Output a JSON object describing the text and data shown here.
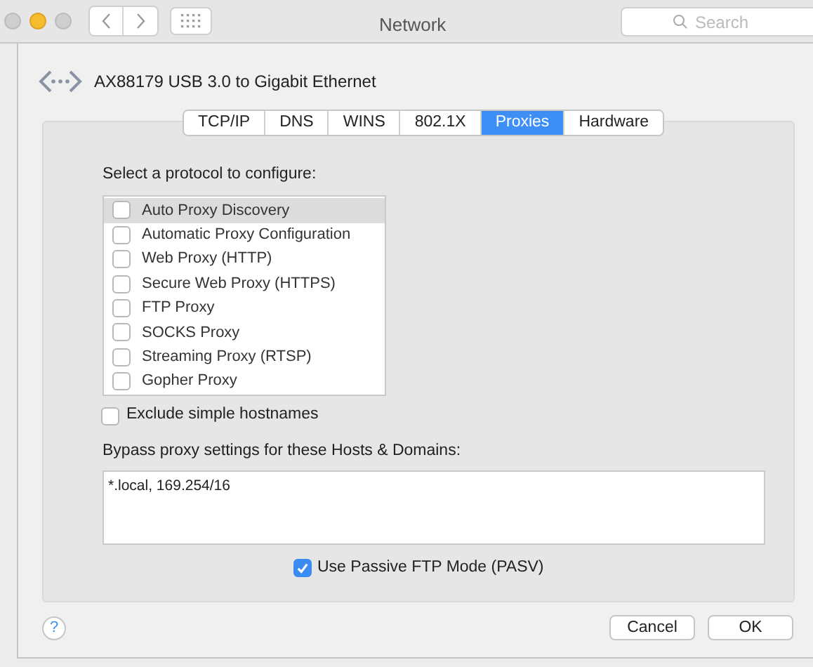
{
  "window": {
    "title": "Network",
    "search": {
      "placeholder": "Search"
    }
  },
  "device": {
    "name": "AX88179 USB 3.0 to Gigabit Ethernet"
  },
  "tabs": [
    {
      "label": "TCP/IP",
      "selected": false
    },
    {
      "label": "DNS",
      "selected": false
    },
    {
      "label": "WINS",
      "selected": false
    },
    {
      "label": "802.1X",
      "selected": false
    },
    {
      "label": "Proxies",
      "selected": true
    },
    {
      "label": "Hardware",
      "selected": false
    }
  ],
  "protocols": {
    "label": "Select a protocol to configure:",
    "items": [
      {
        "label": "Auto Proxy Discovery",
        "checked": false,
        "selected": true
      },
      {
        "label": "Automatic Proxy Configuration",
        "checked": false,
        "selected": false
      },
      {
        "label": "Web Proxy (HTTP)",
        "checked": false,
        "selected": false
      },
      {
        "label": "Secure Web Proxy (HTTPS)",
        "checked": false,
        "selected": false
      },
      {
        "label": "FTP Proxy",
        "checked": false,
        "selected": false
      },
      {
        "label": "SOCKS Proxy",
        "checked": false,
        "selected": false
      },
      {
        "label": "Streaming Proxy (RTSP)",
        "checked": false,
        "selected": false
      },
      {
        "label": "Gopher Proxy",
        "checked": false,
        "selected": false
      }
    ]
  },
  "exclude_simple_hostnames": {
    "label": "Exclude simple hostnames",
    "checked": false
  },
  "bypass": {
    "label": "Bypass proxy settings for these Hosts & Domains:",
    "value": "*.local, 169.254/16"
  },
  "passive_ftp": {
    "label": "Use Passive FTP Mode (PASV)",
    "checked": true
  },
  "help": {
    "label": "?"
  },
  "buttons": [
    "Cancel",
    "OK"
  ]
}
